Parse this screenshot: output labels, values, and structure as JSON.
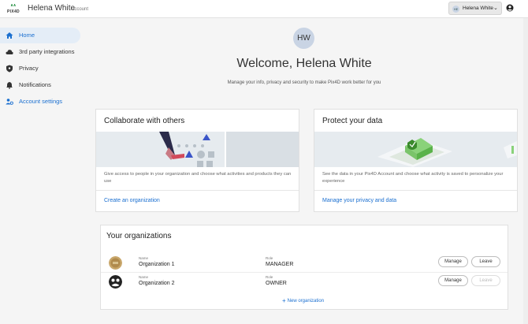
{
  "topbar": {
    "logo_text": "PIX4D",
    "app_name": "Helena White",
    "app_suffix": "account",
    "user_initials": "HE",
    "user_name": "Helena White"
  },
  "sidebar": {
    "items": [
      {
        "label": "Home",
        "icon": "home-icon",
        "active": true
      },
      {
        "label": "3rd party integrations",
        "icon": "cloud-icon"
      },
      {
        "label": "Privacy",
        "icon": "shield-icon"
      },
      {
        "label": "Notifications",
        "icon": "bell-icon"
      },
      {
        "label": "Account settings",
        "icon": "users-gear-icon"
      }
    ]
  },
  "main": {
    "avatar_initials": "HW",
    "welcome": "Welcome, Helena White",
    "subtitle": "Manage your info, privacy and security to make Pix4D work better for you"
  },
  "cards": [
    {
      "title": "Collaborate with others",
      "description": "Give access to people in your organization and choose what activities and products they can use",
      "link": "Create an organization"
    },
    {
      "title": "Protect your data",
      "description": "See the data in your Pix4D Account and choose what activity is saved to personalize your experience",
      "link": "Manage your privacy and data"
    }
  ],
  "organizations": {
    "title": "Your organizations",
    "name_label": "Name",
    "role_label": "Role",
    "manage_label": "Manage",
    "leave_label": "Leave",
    "rows": [
      {
        "name": "Organization 1",
        "role": "MANAGER",
        "leave_enabled": true
      },
      {
        "name": "Organization 2",
        "role": "OWNER",
        "leave_enabled": false
      }
    ],
    "new_label": "New organization"
  },
  "colors": {
    "accent": "#1a6fd0",
    "active_bg": "#e4edf7",
    "avatar_bg": "#c9d4e4"
  }
}
